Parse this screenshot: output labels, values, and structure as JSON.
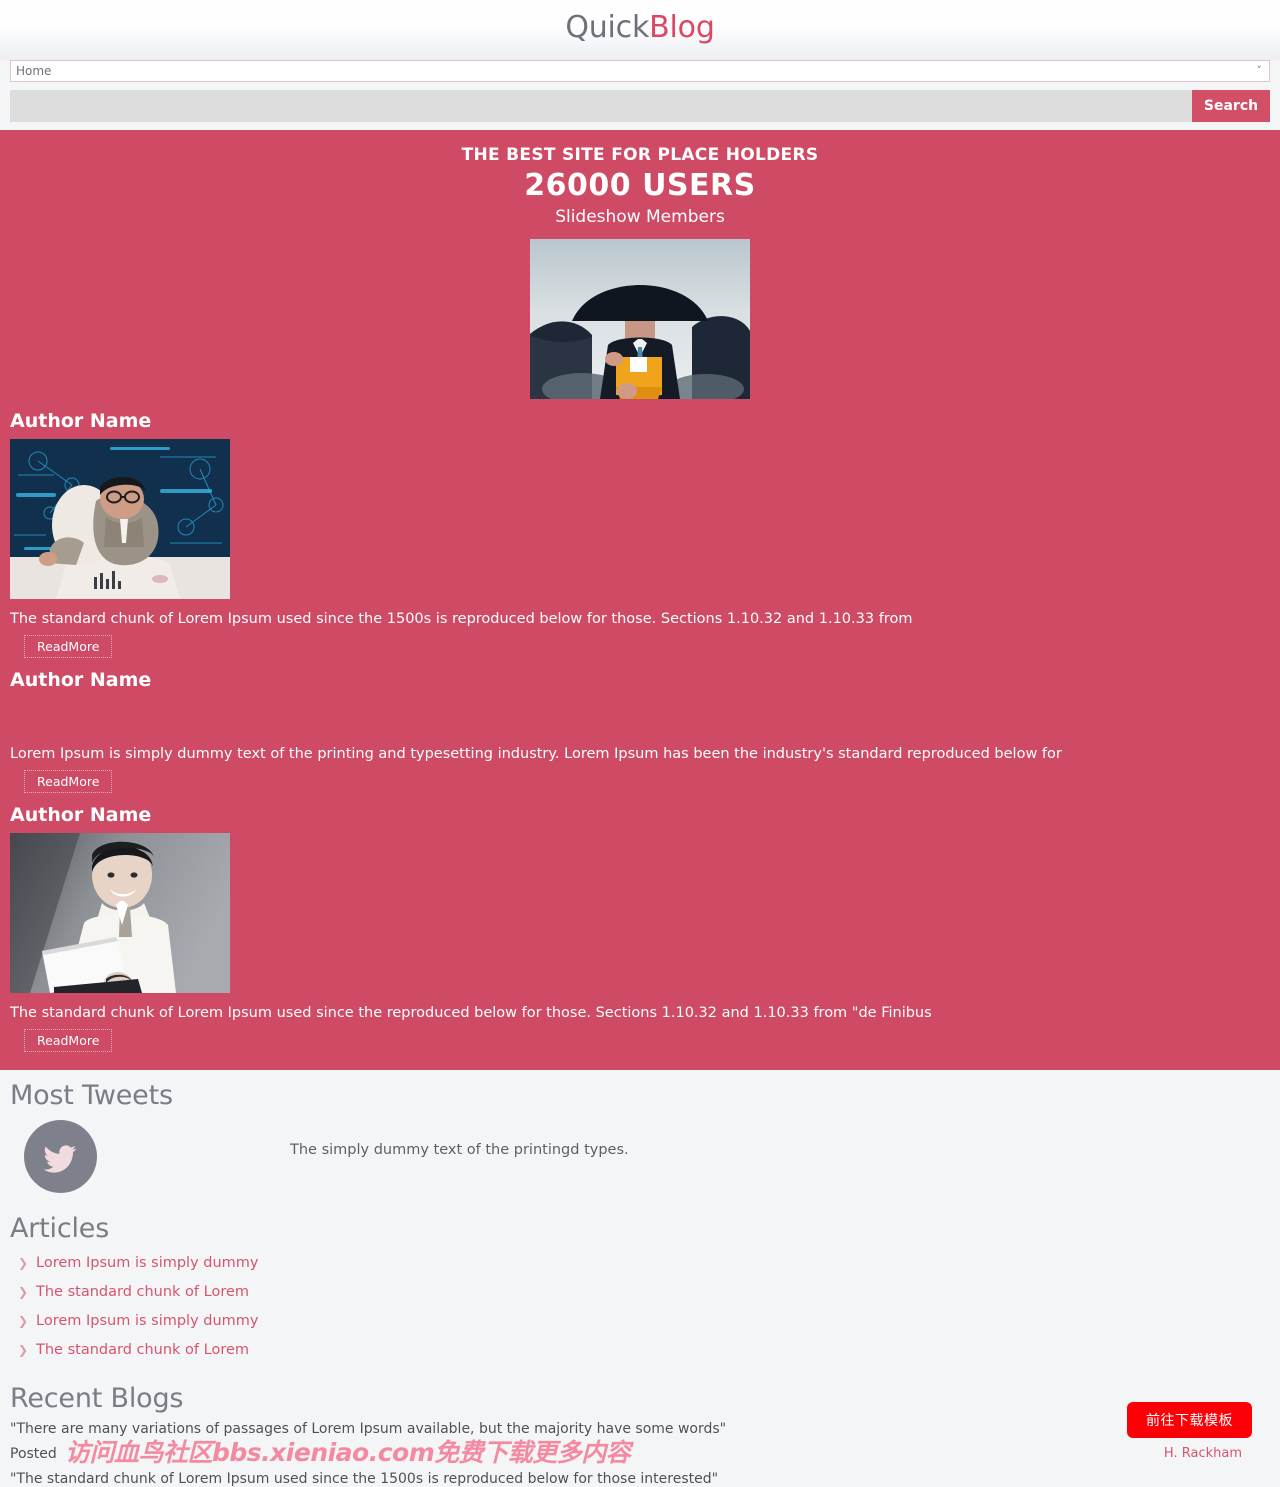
{
  "header": {
    "brand_first": "Quick",
    "brand_second": "Blog"
  },
  "nav": {
    "selected": "Home",
    "options": [
      "Home"
    ],
    "chevron": "chevron-down-icon"
  },
  "search": {
    "value": "",
    "placeholder": "",
    "button_label": "Search"
  },
  "hero": {
    "kicker": "THE BEST SITE FOR PLACE HOLDERS",
    "count": "26000 USERS",
    "subtitle": "Slideshow Members",
    "image_alt": "businessman-with-umbrella-photo"
  },
  "posts": [
    {
      "title": "Author Name",
      "has_image": true,
      "image_alt": "man-at-desk-with-data-visualization-photo",
      "text": "The standard chunk of Lorem Ipsum used since the 1500s is reproduced below for those. Sections 1.10.32 and 1.10.33 from",
      "readmore": "ReadMore"
    },
    {
      "title": "Author Name",
      "has_image": false,
      "image_alt": "",
      "text": "Lorem Ipsum is simply dummy text of the printing and typesetting industry. Lorem Ipsum has been the industry's standard reproduced below for",
      "readmore": "ReadMore"
    },
    {
      "title": "Author Name",
      "has_image": true,
      "image_alt": "smiling-man-with-laptop-photo",
      "text": "The standard chunk of Lorem Ipsum used since the reproduced below for those. Sections 1.10.32 and 1.10.33 from \"de Finibus",
      "readmore": "ReadMore"
    }
  ],
  "tweets": {
    "heading": "Most Tweets",
    "avatar_icon": "twitter-bird-icon",
    "text": "The simply dummy text of the printingd types."
  },
  "articles": {
    "heading": "Articles",
    "items": [
      {
        "label": "Lorem Ipsum is simply dummy"
      },
      {
        "label": "The standard chunk of Lorem"
      },
      {
        "label": "Lorem Ipsum is simply dummy"
      },
      {
        "label": "The standard chunk of Lorem"
      }
    ]
  },
  "recent_blogs": {
    "heading": "Recent Blogs",
    "quote_one": "\"There are many variations of passages of Lorem Ipsum available, but the majority have some words\"",
    "posted_label": "Posted",
    "author": "H. Rackham",
    "quote_two": "\"The standard chunk of Lorem Ipsum used since the 1500s is reproduced below for those interested\""
  },
  "watermark": {
    "text": "访问血鸟社区bbs.xieniao.com免费下载更多内容"
  },
  "download_button": {
    "label": "前往下载模板"
  },
  "colors": {
    "brand_pink": "#d94a62",
    "hero_bg": "#cf4a64",
    "search_button": "#d34f66",
    "link_pink": "#d6556e",
    "heading_gray": "#7a7d85",
    "download_red": "#fb0007",
    "avatar_gray": "#7e818b"
  }
}
